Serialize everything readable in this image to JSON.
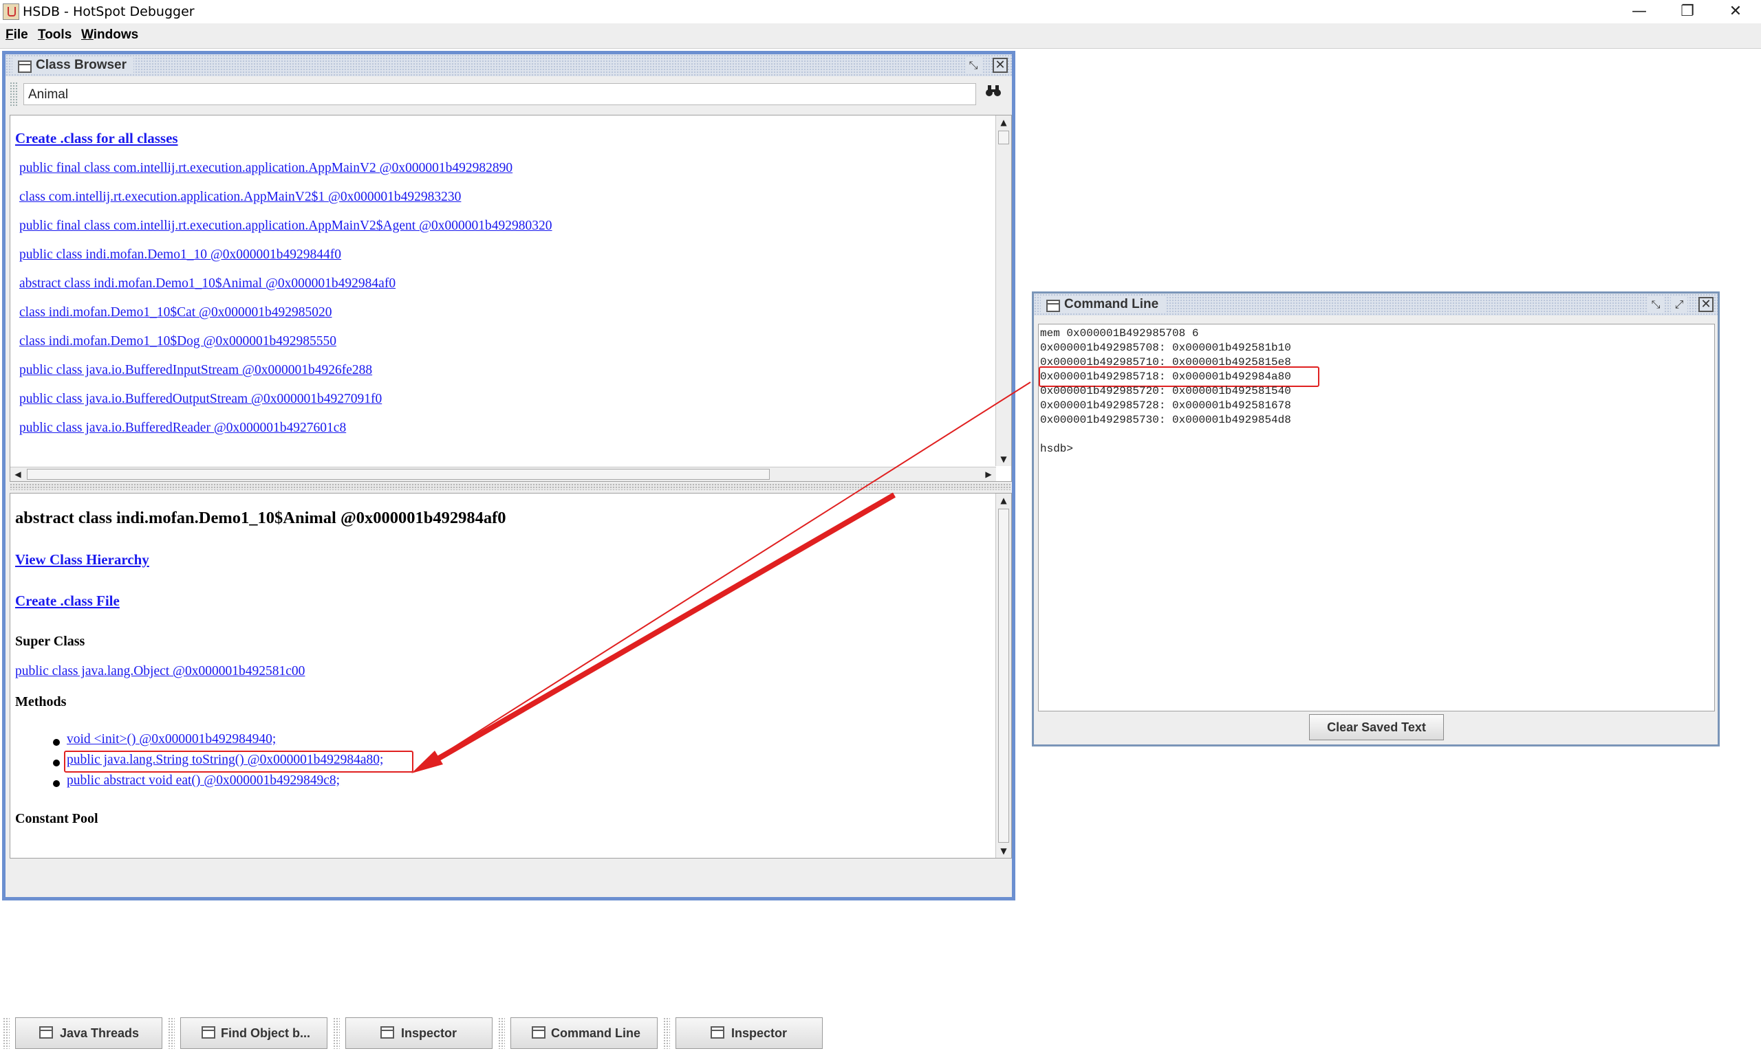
{
  "window": {
    "title": "HSDB - HotSpot Debugger",
    "minimize": "—",
    "restore": "❐",
    "close": "✕"
  },
  "menu": [
    "File",
    "Tools",
    "Windows"
  ],
  "class_browser": {
    "title": "Class Browser",
    "search_value": "Animal",
    "create_all_link": "Create .class for all classes",
    "classes": [
      "public final class com.intellij.rt.execution.application.AppMainV2 @0x000001b492982890",
      "class com.intellij.rt.execution.application.AppMainV2$1 @0x000001b492983230",
      "public final class com.intellij.rt.execution.application.AppMainV2$Agent @0x000001b492980320",
      "public class indi.mofan.Demo1_10 @0x000001b4929844f0",
      "abstract class indi.mofan.Demo1_10$Animal @0x000001b492984af0",
      "class indi.mofan.Demo1_10$Cat @0x000001b492985020",
      "class indi.mofan.Demo1_10$Dog @0x000001b492985550",
      "public class java.io.BufferedInputStream @0x000001b4926fe288",
      "public class java.io.BufferedOutputStream @0x000001b4927091f0",
      "public class java.io.BufferedReader @0x000001b4927601c8"
    ],
    "detail": {
      "heading": "abstract class indi.mofan.Demo1_10$Animal @0x000001b492984af0",
      "view_hierarchy": "View Class Hierarchy",
      "create_class_file": "Create .class File",
      "super_class_label": "Super Class",
      "super_class": "public class java.lang.Object @0x000001b492581c00",
      "methods_label": "Methods",
      "methods": [
        "void <init>() @0x000001b492984940;",
        "public java.lang.String toString() @0x000001b492984a80;",
        "public abstract void eat() @0x000001b4929849c8;"
      ],
      "constant_pool_label": "Constant Pool"
    }
  },
  "command_line": {
    "title": "Command Line",
    "lines": [
      "mem 0x000001B492985708 6",
      "0x000001b492985708: 0x000001b492581b10",
      "0x000001b492985710: 0x000001b4925815e8",
      "0x000001b492985718: 0x000001b492984a80",
      "0x000001b492985720: 0x000001b492581540",
      "0x000001b492985728: 0x000001b492581678",
      "0x000001b492985730: 0x000001b4929854d8",
      "",
      "hsdb>"
    ],
    "clear_button": "Clear Saved Text"
  },
  "taskbar": [
    "Java Threads",
    "Find Object b...",
    "Inspector",
    "Command Line",
    "Inspector"
  ],
  "colors": {
    "link": "#1a1aee",
    "highlight": "#e02020",
    "active_frame_border": "#6b8fd0"
  }
}
